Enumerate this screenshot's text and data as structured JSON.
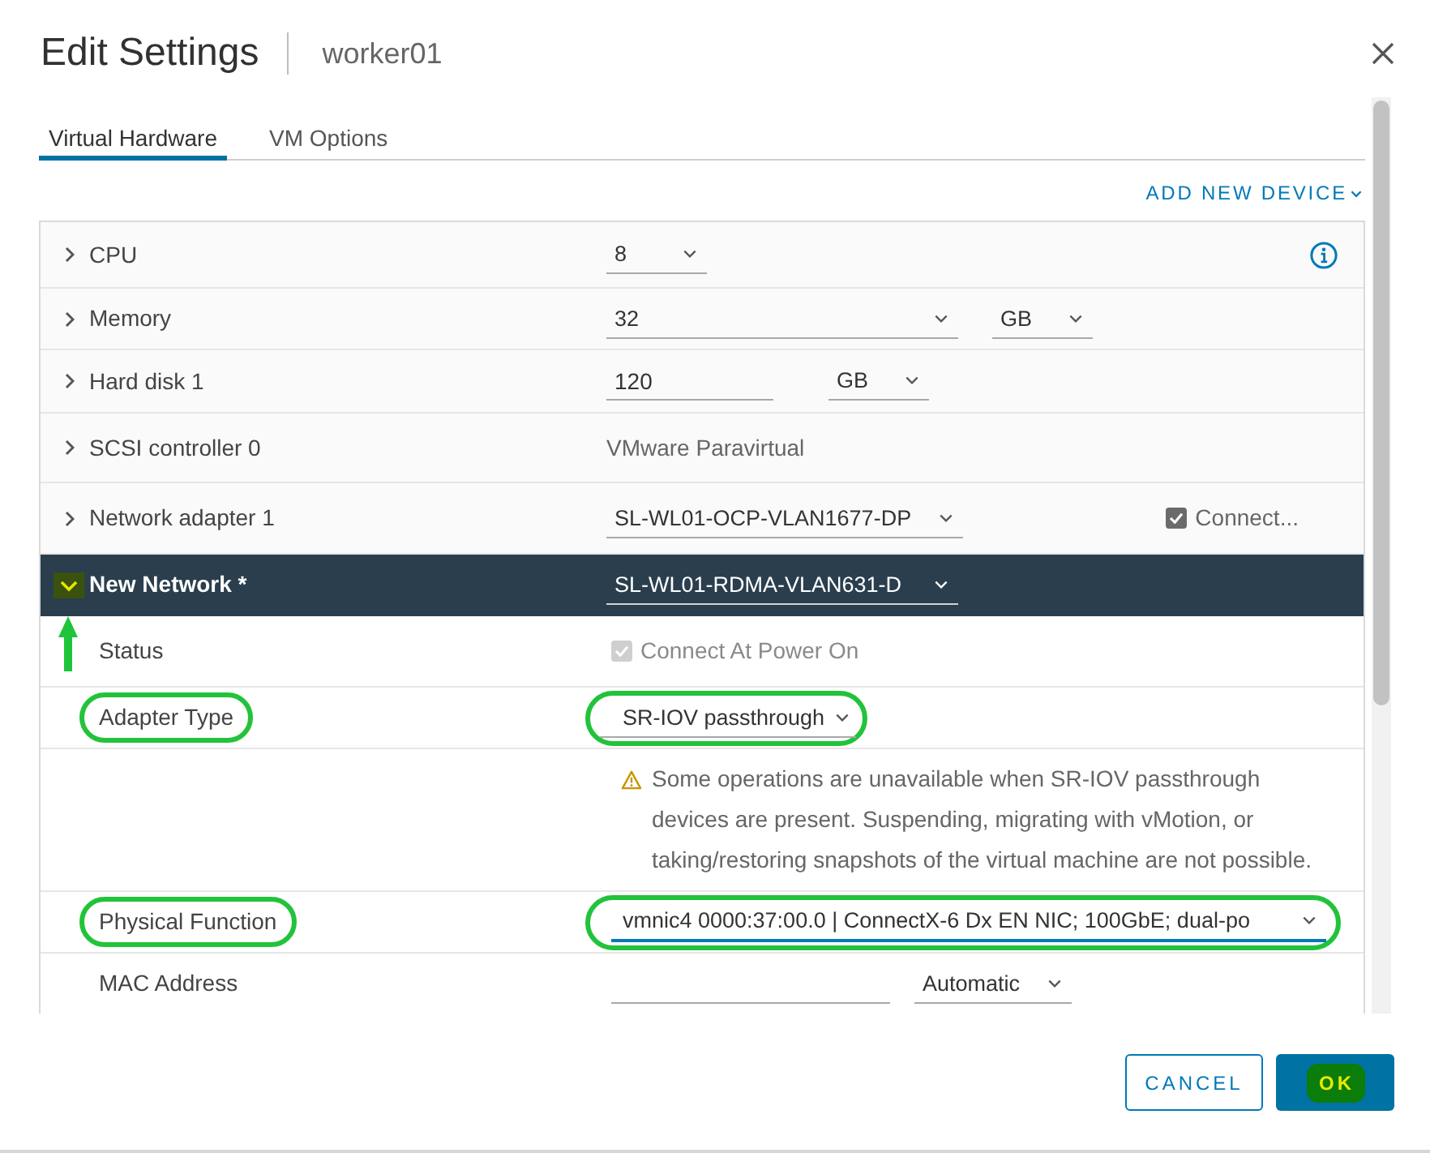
{
  "dialog": {
    "title": "Edit Settings",
    "subtitle": "worker01"
  },
  "tabs": [
    {
      "label": "Virtual Hardware",
      "selected": true
    },
    {
      "label": "VM Options",
      "selected": false
    }
  ],
  "add_device": {
    "label": "ADD NEW DEVICE"
  },
  "hardware": [
    {
      "label": "CPU",
      "expanded": false,
      "selected": false,
      "controls": [
        {
          "kind": "select",
          "value": "8"
        },
        {
          "kind": "info"
        }
      ]
    },
    {
      "label": "Memory",
      "expanded": false,
      "selected": false,
      "controls": [
        {
          "kind": "select",
          "value": "32"
        },
        {
          "kind": "select",
          "value": "GB"
        }
      ]
    },
    {
      "label": "Hard disk 1",
      "expanded": false,
      "selected": false,
      "controls": [
        {
          "kind": "input",
          "value": "120"
        },
        {
          "kind": "select",
          "value": "GB"
        }
      ]
    },
    {
      "label": "SCSI controller 0",
      "expanded": false,
      "selected": false,
      "controls": [
        {
          "kind": "text",
          "value": "VMware Paravirtual"
        }
      ]
    },
    {
      "label": "Network adapter 1",
      "expanded": false,
      "selected": false,
      "controls": [
        {
          "kind": "select",
          "value": "SL-WL01-OCP-VLAN1677-DP"
        },
        {
          "kind": "checkbox",
          "label": "Connect...",
          "checked": true,
          "disabled": false
        }
      ]
    },
    {
      "label": "New Network *",
      "expanded": true,
      "selected": true,
      "expander_highlighted": true,
      "pointer_arrow": true,
      "controls": [
        {
          "kind": "select",
          "value": "SL-WL01-RDMA-VLAN631-D"
        }
      ],
      "children": [
        {
          "label": "Status",
          "circled": false,
          "controls": [
            {
              "kind": "checkbox",
              "label": "Connect At Power On",
              "checked": true,
              "disabled": true
            }
          ]
        },
        {
          "label": "Adapter Type",
          "circled": true,
          "controls": [
            {
              "kind": "select",
              "value": "SR-IOV passthrough",
              "circled": true
            }
          ]
        },
        {
          "controls": [
            {
              "kind": "warning",
              "text": "Some operations are unavailable when SR-IOV passthrough devices are present. Suspending, migrating with vMotion, or taking/restoring snapshots of the virtual machine are not possible."
            }
          ]
        },
        {
          "label": "Physical Function",
          "circled": true,
          "controls": [
            {
              "kind": "select",
              "value": "vmnic4 0000:37:00.0 | ConnectX-6 Dx EN NIC; 100GbE; dual-po",
              "circled": true,
              "focused": true
            }
          ]
        },
        {
          "label": "MAC Address",
          "circled": false,
          "controls": [
            {
              "kind": "input"
            },
            {
              "kind": "select",
              "value": "Automatic"
            }
          ]
        }
      ]
    }
  ],
  "footer": {
    "buttons": [
      {
        "label": "CANCEL",
        "kind": "cancel",
        "highlighted": false
      },
      {
        "label": "OK",
        "kind": "confirm",
        "highlighted": true
      }
    ]
  }
}
